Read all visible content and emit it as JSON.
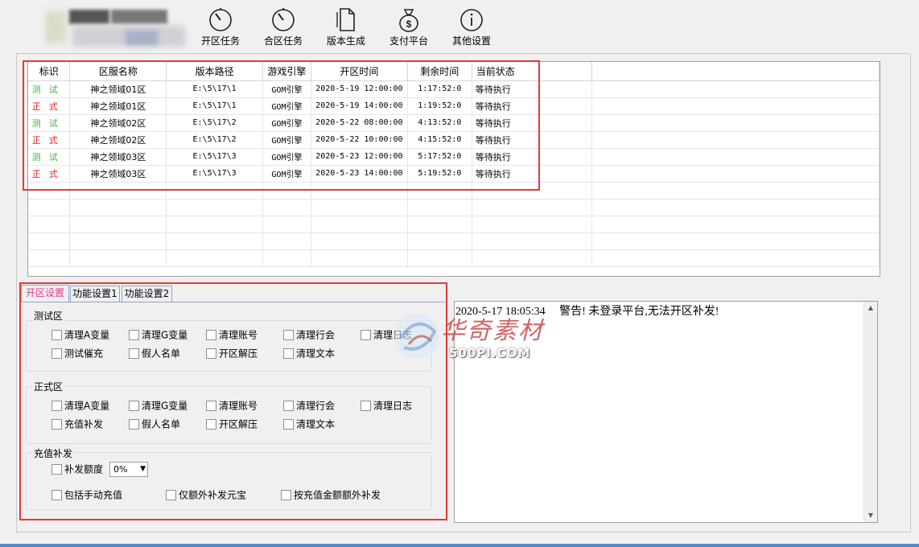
{
  "toolbar": {
    "buttons": [
      {
        "label": "开区任务",
        "icon": "clock-icon"
      },
      {
        "label": "合区任务",
        "icon": "clock-icon"
      },
      {
        "label": "版本生成",
        "icon": "document-icon"
      },
      {
        "label": "支付平台",
        "icon": "money-bag-icon"
      },
      {
        "label": "其他设置",
        "icon": "info-icon"
      }
    ]
  },
  "grid": {
    "columns": [
      "标识",
      "区服名称",
      "版本路径",
      "游戏引擎",
      "开区时间",
      "剩余时间",
      "当前状态"
    ],
    "rows": [
      {
        "tag": "测试",
        "type": "test",
        "name": "神之领域01区",
        "path": "E:\\5\\17\\1",
        "engine": "GOM引擎",
        "open_time": "2020-5-19 12:00:00",
        "remaining": "1:17:52:0",
        "status": "等待执行"
      },
      {
        "tag": "正式",
        "type": "prod",
        "name": "神之领域01区",
        "path": "E:\\5\\17\\1",
        "engine": "GOM引擎",
        "open_time": "2020-5-19 14:00:00",
        "remaining": "1:19:52:0",
        "status": "等待执行"
      },
      {
        "tag": "测试",
        "type": "test",
        "name": "神之领域02区",
        "path": "E:\\5\\17\\2",
        "engine": "GOM引擎",
        "open_time": "2020-5-22 08:00:00",
        "remaining": "4:13:52:0",
        "status": "等待执行"
      },
      {
        "tag": "正式",
        "type": "prod",
        "name": "神之领域02区",
        "path": "E:\\5\\17\\2",
        "engine": "GOM引擎",
        "open_time": "2020-5-22 10:00:00",
        "remaining": "4:15:52:0",
        "status": "等待执行"
      },
      {
        "tag": "测试",
        "type": "test",
        "name": "神之领域03区",
        "path": "E:\\5\\17\\3",
        "engine": "GOM引擎",
        "open_time": "2020-5-23 12:00:00",
        "remaining": "5:17:52:0",
        "status": "等待执行"
      },
      {
        "tag": "正式",
        "type": "prod",
        "name": "神之领域03区",
        "path": "E:\\5\\17\\3",
        "engine": "GOM引擎",
        "open_time": "2020-5-23 14:00:00",
        "remaining": "5:19:52:0",
        "status": "等待执行"
      }
    ],
    "tag_colors": {
      "test": "#3cb83c",
      "prod": "#e02020"
    }
  },
  "tabs": [
    "开区设置",
    "功能设置1",
    "功能设置2"
  ],
  "test_group": {
    "title": "测试区",
    "row1": [
      "清理A变量",
      "清理G变量",
      "清理账号",
      "清理行会",
      "清理日志"
    ],
    "row2": [
      "测试催充",
      "假人名单",
      "开区解压",
      "清理文本"
    ]
  },
  "prod_group": {
    "title": "正式区",
    "row1": [
      "清理A变量",
      "清理G变量",
      "清理账号",
      "清理行会",
      "清理日志"
    ],
    "row2": [
      "充值补发",
      "假人名单",
      "开区解压",
      "清理文本"
    ]
  },
  "recharge_group": {
    "title": "充值补发",
    "amount_label": "补发额度",
    "amount_value": "0%",
    "options": [
      "包括手动充值",
      "仅额外补发元宝",
      "按充值金额额外补发"
    ]
  },
  "log": {
    "line": "2020-5-17 18:05:34     警告! 未登录平台,无法开区补发!"
  },
  "watermark": {
    "zh": "华奇素材",
    "en": "500PI.COM"
  },
  "colors": {
    "highlight_box": "#e53935",
    "active_tab": "#e0408a"
  }
}
